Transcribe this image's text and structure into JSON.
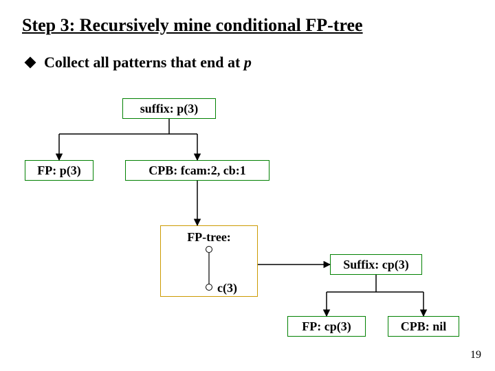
{
  "title": "Step 3: Recursively mine conditional FP-tree",
  "bullet": {
    "prefix": "Collect all patterns that end at ",
    "var": "p"
  },
  "boxes": {
    "suffix_p": "suffix: p(3)",
    "fp_p": "FP: p(3)",
    "cpb_p": "CPB: fcam:2, cb:1",
    "fptree": "FP-tree:",
    "suffix_cp": "Suffix: cp(3)",
    "fp_cp": "FP: cp(3)",
    "cpb_nil": "CPB: nil"
  },
  "c3_label": "c(3)",
  "page": "19",
  "colors": {
    "green": "#008000",
    "orange": "#cc9900"
  }
}
